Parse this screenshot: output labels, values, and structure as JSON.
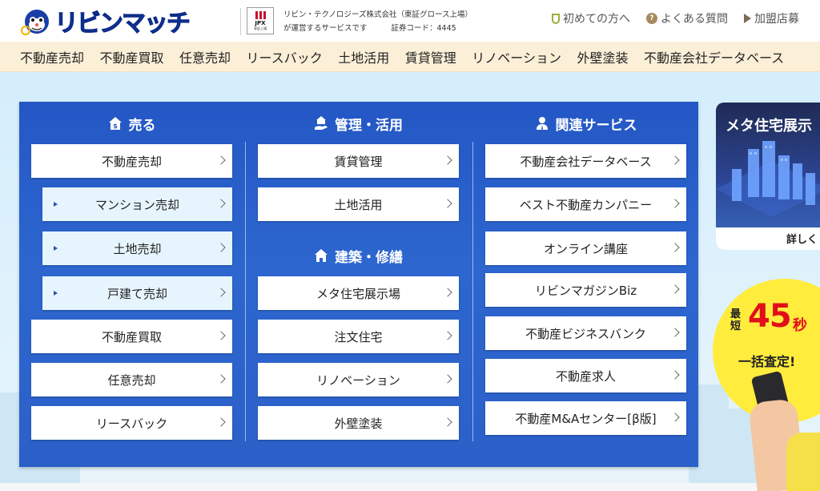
{
  "header": {
    "logo_text": "リビンマッチ",
    "jpx_mark": "JPX",
    "jpx_sub": "東証上場",
    "company_line1": "リビン・テクノロジーズ株式会社（東証グロース上場）",
    "company_line2": "が運営するサービスです",
    "company_code": "証券コード：4445",
    "nav": [
      {
        "label": "初めての方へ",
        "icon": "shield-icon"
      },
      {
        "label": "よくある質問",
        "icon": "question-icon"
      },
      {
        "label": "加盟店募",
        "icon": "flag-icon"
      }
    ]
  },
  "categories": [
    "不動産売却",
    "不動産買取",
    "任意売却",
    "リースバック",
    "土地活用",
    "賃貸管理",
    "リノベーション",
    "外壁塗装",
    "不動産会社データベース"
  ],
  "panel": {
    "sell": {
      "title": "売る",
      "items": [
        {
          "label": "不動産売却",
          "sub": false
        },
        {
          "label": "マンション売却",
          "sub": true
        },
        {
          "label": "土地売却",
          "sub": true
        },
        {
          "label": "戸建て売却",
          "sub": true
        },
        {
          "label": "不動産買取",
          "sub": false
        },
        {
          "label": "任意売却",
          "sub": false
        },
        {
          "label": "リースバック",
          "sub": false
        }
      ]
    },
    "manage": {
      "title": "管理・活用",
      "items": [
        "賃貸管理",
        "土地活用"
      ]
    },
    "build": {
      "title": "建築・修繕",
      "items": [
        "メタ住宅展示場",
        "注文住宅",
        "リノベーション",
        "外壁塗装"
      ]
    },
    "related": {
      "title": "関連サービス",
      "items": [
        "不動産会社データベース",
        "ベスト不動産カンパニー",
        "オンライン講座",
        "リビンマガジンBiz",
        "不動産ビジネスバンク",
        "不動産求人",
        "不動産M&Aセンター[β版]"
      ]
    }
  },
  "banners": {
    "meta": {
      "title": "メタ住宅展示",
      "more": "詳しく"
    },
    "quick": {
      "small": "最短",
      "number": "45",
      "unit": "秒",
      "caption": "一括査定!"
    }
  },
  "colors": {
    "panel_blue": "#2b60c8",
    "category_bar": "#fcefd8",
    "accent_red": "#e20e1b",
    "banner_yellow": "#ffec3d"
  }
}
